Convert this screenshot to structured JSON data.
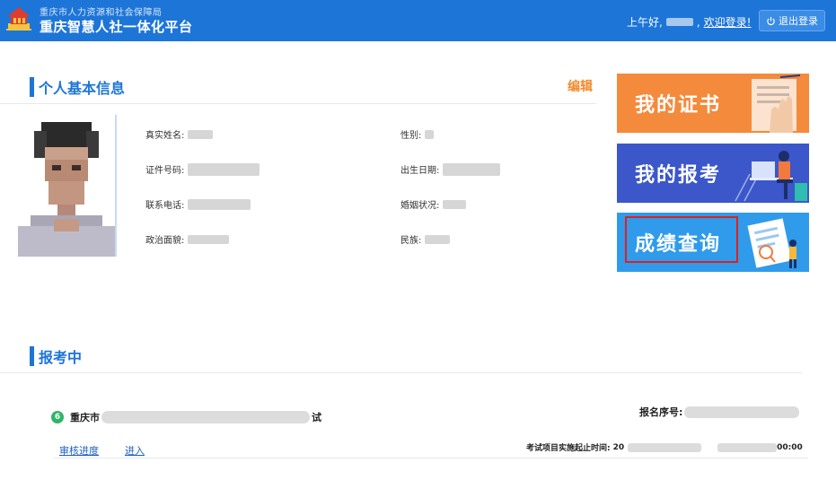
{
  "header": {
    "org_name": "重庆市人力资源和社会保障局",
    "platform_name": "重庆智慧人社一体化平台",
    "greeting_prefix": "上午好,",
    "greeting_suffix": ",",
    "welcome": "欢迎登录!",
    "logout_label": "退出登录"
  },
  "profile": {
    "section_title": "个人基本信息",
    "edit_label": "编辑",
    "fields": {
      "real_name": "真实姓名:",
      "gender": "性别:",
      "id_number": "证件号码:",
      "birth_date": "出生日期:",
      "phone": "联系电话:",
      "marital": "婚姻状况:",
      "political": "政治面貌:",
      "ethnicity": "民族:"
    }
  },
  "quick_links": [
    {
      "label": "我的证书",
      "color": "#f48a3c"
    },
    {
      "label": "我的报考",
      "color": "#3b57c9"
    },
    {
      "label": "成绩查询",
      "color": "#2f9bea"
    }
  ],
  "exams": {
    "section_title": "报考中",
    "item": {
      "status_icon": "6",
      "name_prefix": "重庆市",
      "name_suffix": "试",
      "reg_label": "报名序号:",
      "progress_link": "审核进度",
      "enter_link": "进入",
      "period_label": "考试项目实施起止时间:",
      "period_start": "20",
      "period_end": "00:00"
    }
  }
}
